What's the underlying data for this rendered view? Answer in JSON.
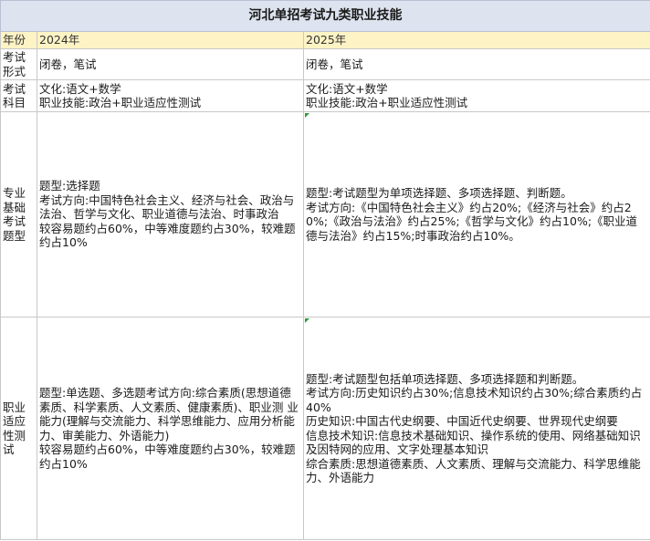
{
  "title": "河北单招考试九类职业技能",
  "header": {
    "col0": "年份",
    "col1": "2024年",
    "col2": "2025年"
  },
  "rows": [
    {
      "label": "考试形式",
      "c2024": [
        "闭卷，笔试"
      ],
      "c2025": [
        "闭卷，笔试"
      ]
    },
    {
      "label": "考试科目",
      "c2024": [
        "文化:语文+数学",
        "职业技能:政治+职业适应性测试"
      ],
      "c2025": [
        "文化:语文+数学",
        "职业技能:政治+职业适应性测试"
      ]
    },
    {
      "label": "专业基础考试题型",
      "c2024": [
        "题型:选择题",
        "考试方向:中国特色社会主义、经济与社会、政治与法治、哲学与文化、职业道德与法治、时事政治",
        "较容易题约占60%，中等难度题约占30%，较难题约占10%"
      ],
      "c2025": [
        "题型:考试题型为单项选择题、多项选择题、判断题。",
        "考试方向:《中国特色社会主义》约占20%;《经济与社会》约占20%;《政治与法治》约占25%;《哲学与文化》约占10%;《职业道德与法治》约占15%;时事政治约占10%。"
      ]
    },
    {
      "label": "职业适应性测试",
      "c2024": [
        "题型:单选题、多选题考试方向:综合素质(思想道德素质、科学素质、人文素质、健康素质)、职业测 业能力(理解与交流能力、科学思维能力、应用分析能力、审美能力、外语能力)",
        "较容易题约占60%，中等难度题约占30%，较难题约占10%"
      ],
      "c2025": [
        "题型:考试题型包括单项选择题、多项选择题和判断题。",
        "考试方向:历史知识约占30%;信息技术知识约占30%;综合素质约占40%",
        "历史知识:中国古代史纲要、中国近代史纲要、世界现代史纲要",
        "信息技术知识:信息技术基础知识、操作系统的使用、网络基础知识及因特网的应用、文字处理基本知识",
        "综合素质:思想道德素质、人文素质、理解与交流能力、科学思维能力、外语能力"
      ]
    }
  ]
}
